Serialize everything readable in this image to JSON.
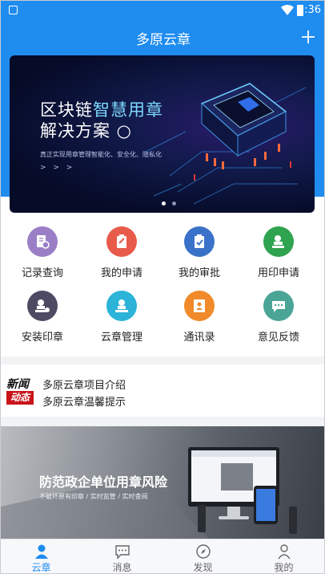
{
  "status_bar": {
    "time": "1:36"
  },
  "header": {
    "title": "多原云章",
    "action_icon": "plus-icon"
  },
  "colors": {
    "primary": "#1f8cf0",
    "news_red": "#c9141b"
  },
  "banner": {
    "title_prefix": "区块链",
    "title_highlight": "智慧用章",
    "title_line2": "解决方案 ○",
    "subtitle": "真正实现用章管理智能化、安全化、隐私化",
    "arrows": "> > >",
    "active_slide": 1,
    "slide_count": 2
  },
  "grid": [
    {
      "label": "记录查询",
      "icon": "record-search-icon",
      "color": "#9a7fc6"
    },
    {
      "label": "我的申请",
      "icon": "my-application-icon",
      "color": "#e85a4a"
    },
    {
      "label": "我的审批",
      "icon": "my-approval-icon",
      "color": "#3b72c9"
    },
    {
      "label": "用印申请",
      "icon": "seal-application-icon",
      "color": "#2fa34f"
    },
    {
      "label": "安装印章",
      "icon": "install-seal-icon",
      "color": "#4e4a63"
    },
    {
      "label": "云章管理",
      "icon": "cloud-seal-manage-icon",
      "color": "#2cb3d8"
    },
    {
      "label": "通讯录",
      "icon": "contacts-icon",
      "color": "#f08a2a"
    },
    {
      "label": "意见反馈",
      "icon": "feedback-icon",
      "color": "#4aa596"
    }
  ],
  "news": {
    "logo_top": "新闻",
    "logo_bottom": "动态",
    "items": [
      "多原云章项目介绍",
      "多原云章温馨提示"
    ]
  },
  "promo": {
    "title": "防范政企单位用章风险",
    "subtitle": "不破坏原有印章 / 实时监管 / 实时查阅"
  },
  "tabs": [
    {
      "label": "云章",
      "icon": "person-icon",
      "active": true
    },
    {
      "label": "消息",
      "icon": "message-icon",
      "active": false
    },
    {
      "label": "发现",
      "icon": "compass-icon",
      "active": false
    },
    {
      "label": "我的",
      "icon": "profile-icon",
      "active": false
    }
  ]
}
